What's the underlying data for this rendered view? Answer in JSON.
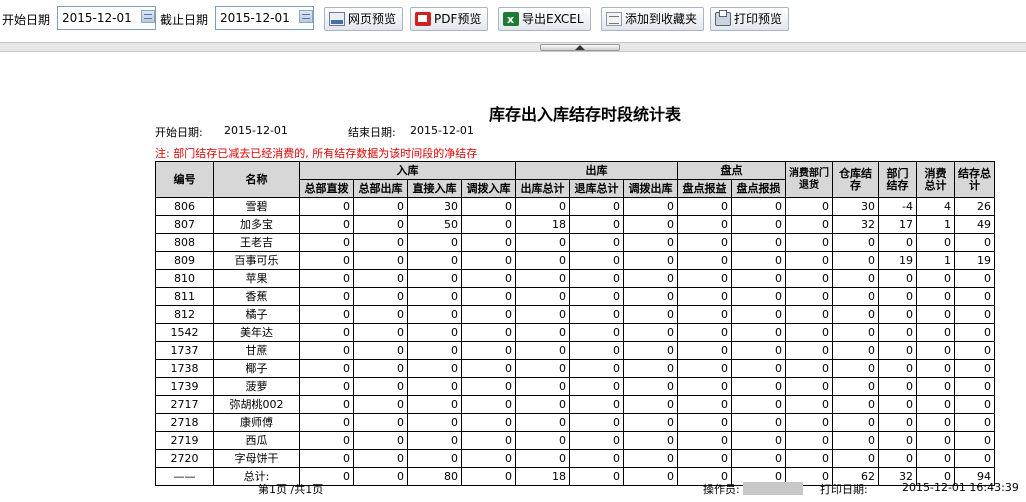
{
  "toolbar": {
    "start_label": "开始日期",
    "start_value": "2015-12-01",
    "end_label": "截止日期",
    "end_value": "2015-12-01",
    "buttons": [
      {
        "label": "网页预览",
        "icon": "web-preview-icon"
      },
      {
        "label": "PDF预览",
        "icon": "pdf-icon"
      },
      {
        "label": "导出EXCEL",
        "icon": "excel-icon"
      },
      {
        "label": "添加到收藏夹",
        "icon": "favorites-icon"
      },
      {
        "label": "打印预览",
        "icon": "printer-icon"
      }
    ]
  },
  "report": {
    "title": "库存出入库结存时段统计表",
    "start_label": "开始日期:",
    "start_value": "2015-12-01",
    "end_label": "结束日期:",
    "end_value": "2015-12-01",
    "note": "注: 部门结存已减去已经消费的, 所有结存数据为该时间段的净结存",
    "group_headers": {
      "inbound": "入库",
      "outbound": "出库",
      "inventory": "盘点"
    },
    "columns": {
      "code": "编号",
      "name": "名称",
      "dept_direct": "总部直拨",
      "dept_out": "总部出库",
      "direct_in": "直接入库",
      "transfer_in": "调拨入库",
      "out_total": "出库总计",
      "return_total": "退库总计",
      "transfer_out": "调拨出库",
      "gain": "盘点报益",
      "loss": "盘点报损",
      "consume_return": "消费部门退货",
      "warehouse_stock": "仓库结存",
      "dept_stock": "部门结存",
      "consume_total": "消费总计",
      "stock_total": "结存总计"
    },
    "rows": [
      [
        "806",
        "雪碧",
        "0",
        "0",
        "30",
        "0",
        "0",
        "0",
        "0",
        "0",
        "0",
        "0",
        "30",
        "-4",
        "4",
        "26"
      ],
      [
        "807",
        "加多宝",
        "0",
        "0",
        "50",
        "0",
        "18",
        "0",
        "0",
        "0",
        "0",
        "0",
        "32",
        "17",
        "1",
        "49"
      ],
      [
        "808",
        "王老吉",
        "0",
        "0",
        "0",
        "0",
        "0",
        "0",
        "0",
        "0",
        "0",
        "0",
        "0",
        "0",
        "0",
        "0"
      ],
      [
        "809",
        "百事可乐",
        "0",
        "0",
        "0",
        "0",
        "0",
        "0",
        "0",
        "0",
        "0",
        "0",
        "0",
        "19",
        "1",
        "19"
      ],
      [
        "810",
        "苹果",
        "0",
        "0",
        "0",
        "0",
        "0",
        "0",
        "0",
        "0",
        "0",
        "0",
        "0",
        "0",
        "0",
        "0"
      ],
      [
        "811",
        "香蕉",
        "0",
        "0",
        "0",
        "0",
        "0",
        "0",
        "0",
        "0",
        "0",
        "0",
        "0",
        "0",
        "0",
        "0"
      ],
      [
        "812",
        "橘子",
        "0",
        "0",
        "0",
        "0",
        "0",
        "0",
        "0",
        "0",
        "0",
        "0",
        "0",
        "0",
        "0",
        "0"
      ],
      [
        "1542",
        "美年达",
        "0",
        "0",
        "0",
        "0",
        "0",
        "0",
        "0",
        "0",
        "0",
        "0",
        "0",
        "0",
        "0",
        "0"
      ],
      [
        "1737",
        "甘蔗",
        "0",
        "0",
        "0",
        "0",
        "0",
        "0",
        "0",
        "0",
        "0",
        "0",
        "0",
        "0",
        "0",
        "0"
      ],
      [
        "1738",
        "椰子",
        "0",
        "0",
        "0",
        "0",
        "0",
        "0",
        "0",
        "0",
        "0",
        "0",
        "0",
        "0",
        "0",
        "0"
      ],
      [
        "1739",
        "菠萝",
        "0",
        "0",
        "0",
        "0",
        "0",
        "0",
        "0",
        "0",
        "0",
        "0",
        "0",
        "0",
        "0",
        "0"
      ],
      [
        "2717",
        "弥胡桃002",
        "0",
        "0",
        "0",
        "0",
        "0",
        "0",
        "0",
        "0",
        "0",
        "0",
        "0",
        "0",
        "0",
        "0"
      ],
      [
        "2718",
        "康师傅",
        "0",
        "0",
        "0",
        "0",
        "0",
        "0",
        "0",
        "0",
        "0",
        "0",
        "0",
        "0",
        "0",
        "0"
      ],
      [
        "2719",
        "西瓜",
        "0",
        "0",
        "0",
        "0",
        "0",
        "0",
        "0",
        "0",
        "0",
        "0",
        "0",
        "0",
        "0",
        "0"
      ],
      [
        "2720",
        "字母饼干",
        "0",
        "0",
        "0",
        "0",
        "0",
        "0",
        "0",
        "0",
        "0",
        "0",
        "0",
        "0",
        "0",
        "0"
      ]
    ],
    "total_row": [
      "——",
      "总计:",
      "0",
      "0",
      "80",
      "0",
      "18",
      "0",
      "0",
      "0",
      "0",
      "0",
      "62",
      "32",
      "0",
      "94"
    ],
    "footer": {
      "page": "第1页 /共1页",
      "operator_label": "操作员:",
      "print_date_label": "打印日期:",
      "print_date_value": "2015-12-01 16:43:39"
    }
  }
}
